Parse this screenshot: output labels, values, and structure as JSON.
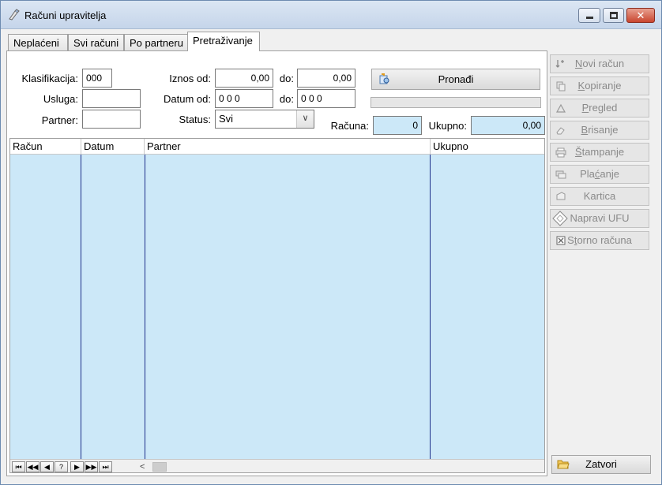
{
  "window": {
    "title": "Računi upravitelja"
  },
  "titlebar": {
    "close_glyph": "✕"
  },
  "tabs": [
    {
      "label": "Neplaćeni"
    },
    {
      "label": "Svi računi"
    },
    {
      "label": "Po partneru"
    },
    {
      "label": "Pretraživanje"
    }
  ],
  "form": {
    "klasifikacija_label": "Klasifikacija:",
    "klasifikacija_value": "000",
    "usluga_label": "Usluga:",
    "usluga_value": "",
    "partner_label": "Partner:",
    "partner_value": "",
    "iznos_od_label": "Iznos od:",
    "iznos_od_value": "0,00",
    "iznos_do_label": "do:",
    "iznos_do_value": "0,00",
    "datum_od_label": "Datum od:",
    "datum_od_value": "0 0 0",
    "datum_do_label": "do:",
    "datum_do_value": "0 0 0",
    "status_label": "Status:",
    "status_value": "Svi",
    "pronadji_label": "Pronađi",
    "racuna_label": "Računa:",
    "racuna_value": "0",
    "ukupno_label": "Ukupno:",
    "ukupno_value": "0,00"
  },
  "grid": {
    "columns": [
      {
        "label": "Račun"
      },
      {
        "label": "Datum"
      },
      {
        "label": "Partner"
      },
      {
        "label": "Ukupno"
      }
    ],
    "nav": [
      "⏮",
      "◀◀",
      "◀",
      "?",
      "▶",
      "▶▶",
      "⏭"
    ]
  },
  "sidebar": {
    "buttons": [
      {
        "pre": "",
        "u": "N",
        "post": "ovi račun",
        "icon": "new-icon"
      },
      {
        "pre": "",
        "u": "K",
        "post": "opiranje",
        "icon": "copy-icon"
      },
      {
        "pre": "",
        "u": "P",
        "post": "regled",
        "icon": "preview-icon"
      },
      {
        "pre": "",
        "u": "B",
        "post": "risanje",
        "icon": "eraser-icon"
      },
      {
        "pre": "",
        "u": "Š",
        "post": "tampanje",
        "icon": "printer-icon"
      },
      {
        "pre": "Pla",
        "u": "ć",
        "post": "anje",
        "icon": "payment-icon"
      },
      {
        "pre": "",
        "u": "",
        "post": "Kartica",
        "icon": "card-icon"
      },
      {
        "pre": "Napravi UFU",
        "u": "",
        "post": "",
        "icon": "diamond-icon"
      },
      {
        "pre": "S",
        "u": "t",
        "post": "orno računa",
        "icon": "storno-icon"
      }
    ],
    "close_label": "Zatvori"
  }
}
